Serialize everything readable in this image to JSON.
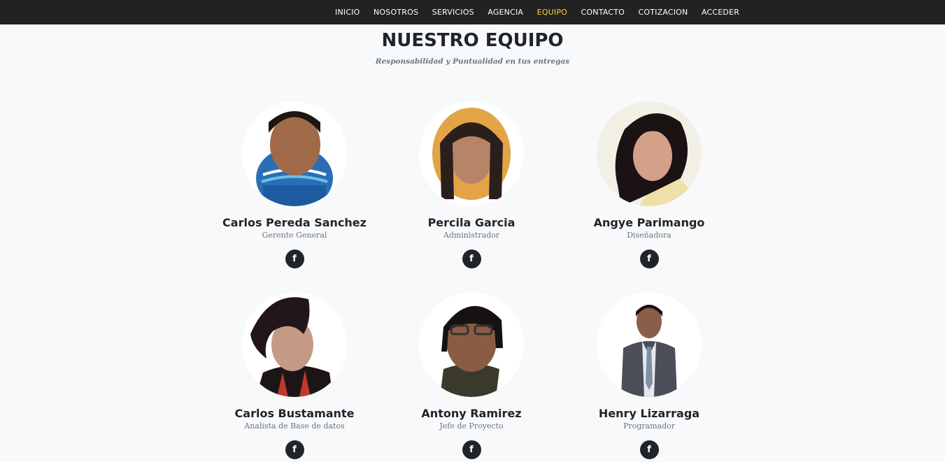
{
  "nav": {
    "items": [
      {
        "label": "INICIO",
        "active": false
      },
      {
        "label": "NOSOTROS",
        "active": false
      },
      {
        "label": "SERVICIOS",
        "active": false
      },
      {
        "label": "AGENCIA",
        "active": false
      },
      {
        "label": "EQUIPO",
        "active": true
      },
      {
        "label": "CONTACTO",
        "active": false
      },
      {
        "label": "COTIZACION",
        "active": false
      },
      {
        "label": "ACCEDER",
        "active": false
      }
    ],
    "active_color": "#fed136"
  },
  "section": {
    "heading": "NUESTRO EQUIPO",
    "subheading": "Responsabilidad y Puntualidad en tus entregas"
  },
  "team": [
    {
      "name": "Carlos Pereda Sanchez",
      "role": "Gerente General",
      "social_icon": "facebook-icon",
      "social_glyph": "f"
    },
    {
      "name": "Percila Garcia",
      "role": "Administrador",
      "social_icon": "facebook-icon",
      "social_glyph": "f"
    },
    {
      "name": "Angye Parimango",
      "role": "Diseñadora",
      "social_icon": "facebook-icon",
      "social_glyph": "f"
    },
    {
      "name": "Carlos Bustamante",
      "role": "Analista de Base de datos",
      "social_icon": "facebook-icon",
      "social_glyph": "f"
    },
    {
      "name": "Antony Ramirez",
      "role": "Jefe de Proyecto",
      "social_icon": "facebook-icon",
      "social_glyph": "f"
    },
    {
      "name": "Henry Lizarraga",
      "role": "Programador",
      "social_icon": "facebook-icon",
      "social_glyph": "f"
    }
  ]
}
